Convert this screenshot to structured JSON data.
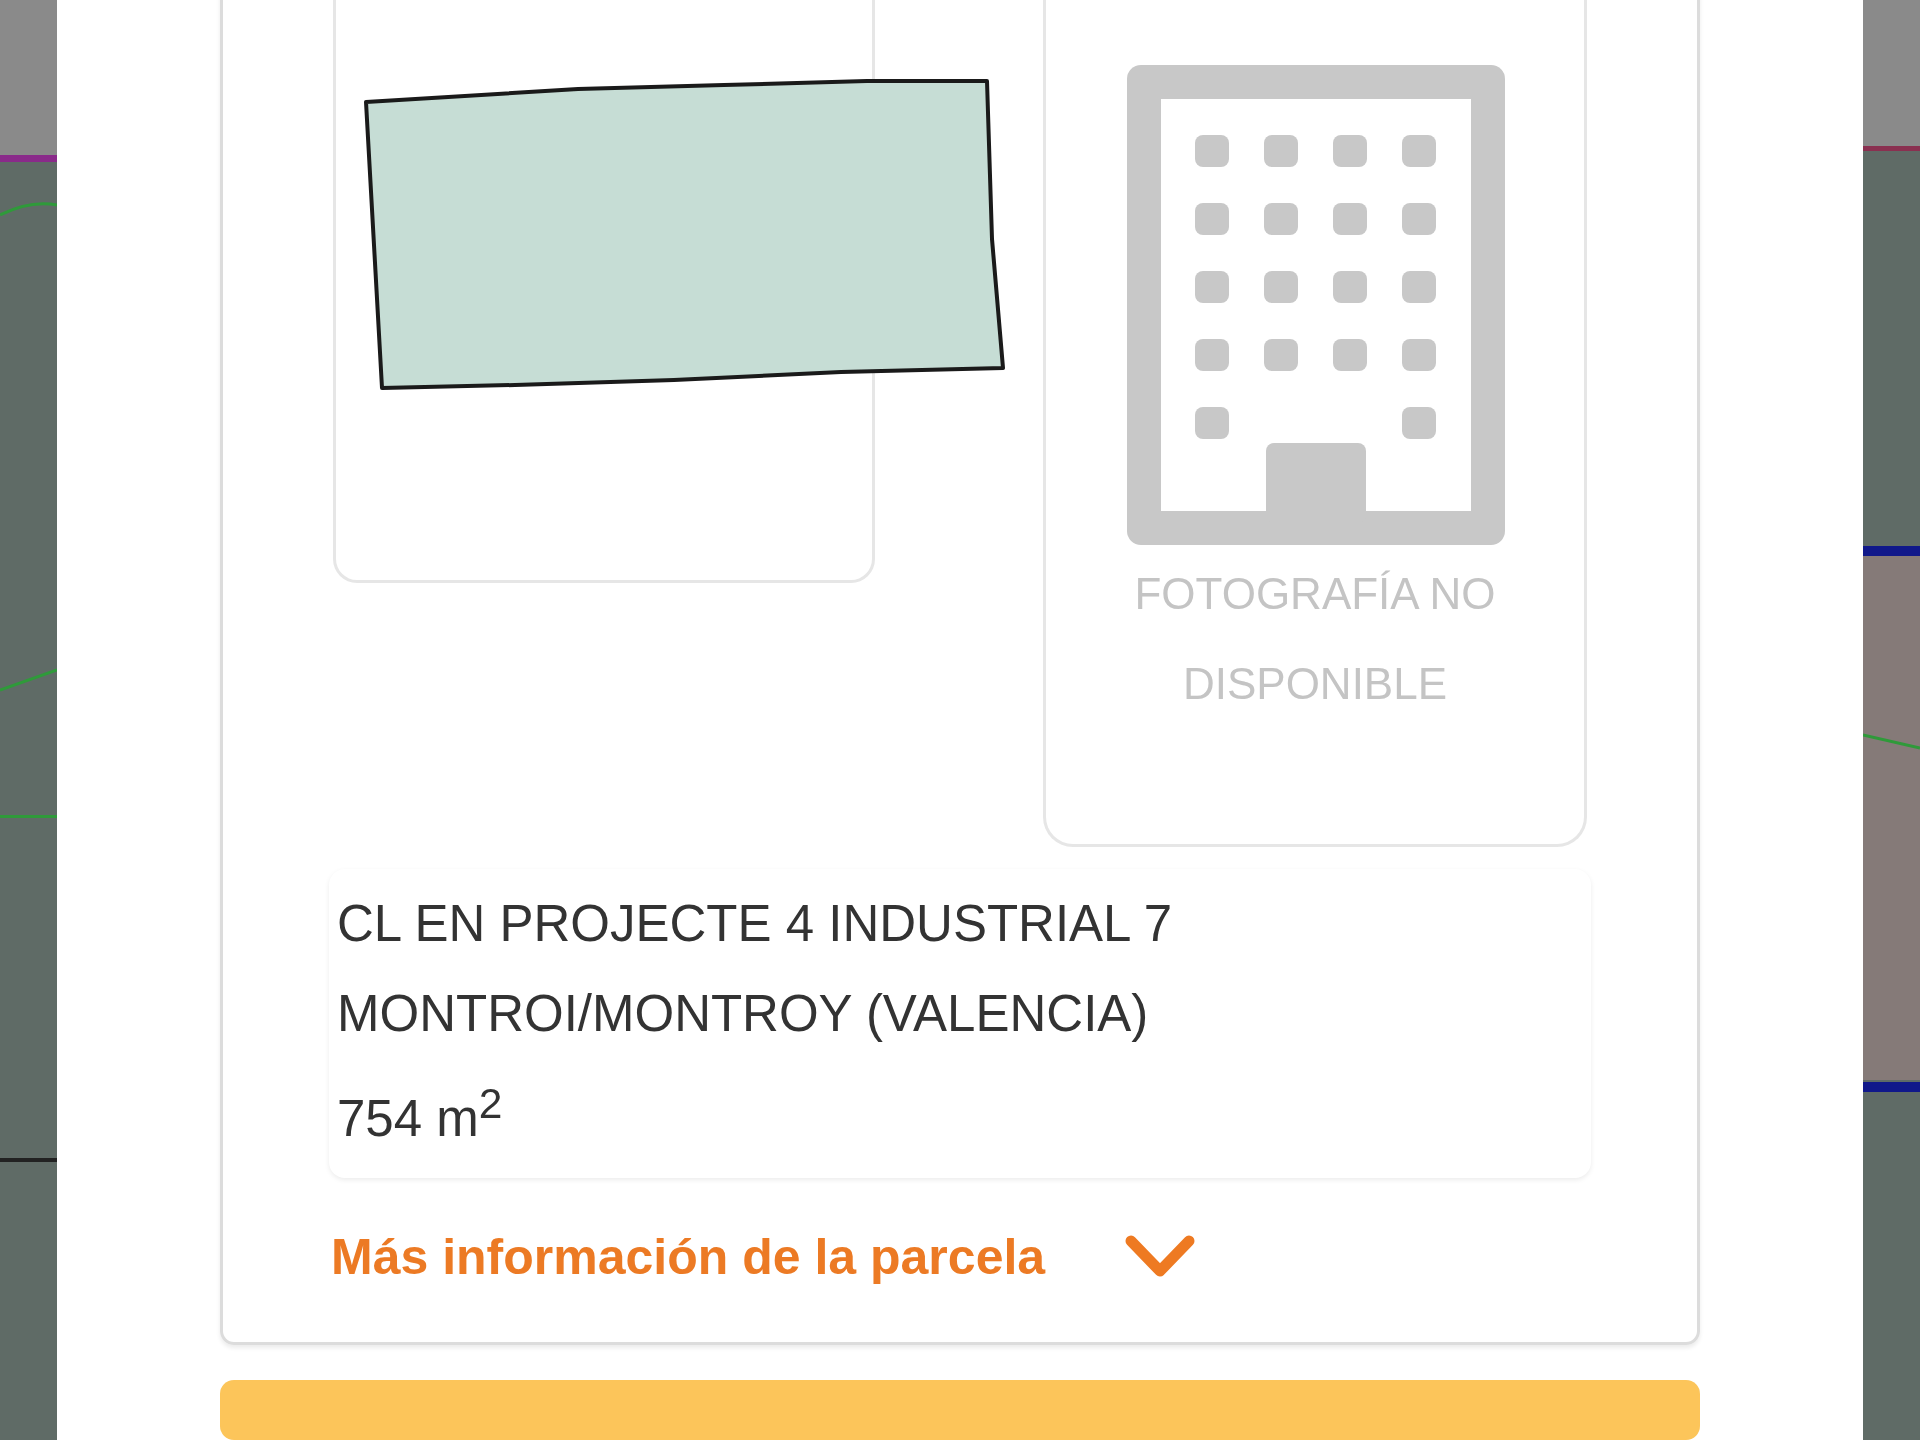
{
  "parcel": {
    "address_lines": [
      "CL EN PROJECTE 4 INDUSTRIAL 7",
      "MONTROI/MONTROY (VALENCIA)"
    ],
    "area": "754 m$^{2}$"
  },
  "photo": {
    "placeholder": "FOTOGRAFÍA NO DISPONIBLE"
  },
  "more_info": {
    "label": "Más información de la parcela",
    "expanded": false
  }
}
